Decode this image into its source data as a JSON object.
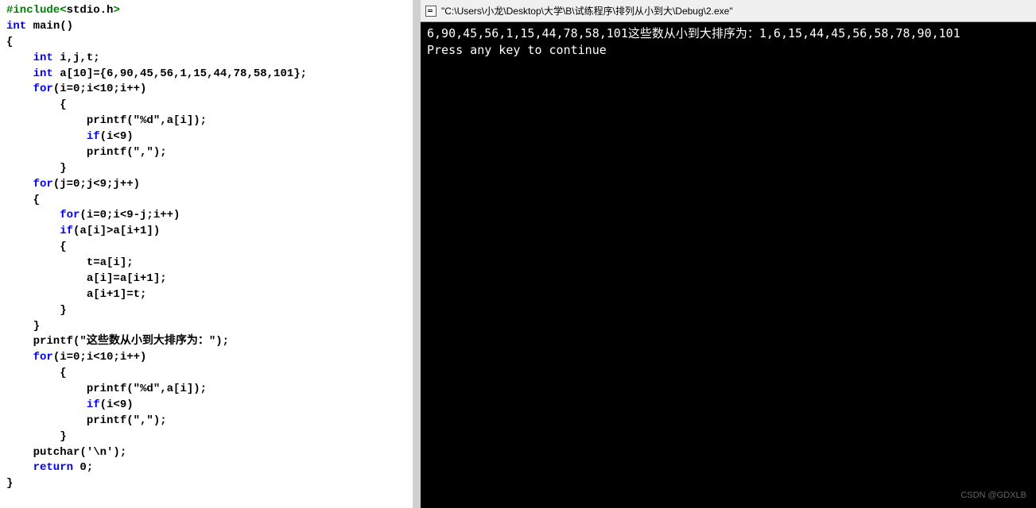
{
  "editor": {
    "line01_p1": "#include<",
    "line01_p2": "stdio.h",
    "line01_p3": ">",
    "line02_p1": "int",
    "line02_p2": " main()",
    "line03": "{",
    "line04_p1": "    int",
    "line04_p2": " i,j,t;",
    "line05_p1": "    int",
    "line05_p2": " a[10]={6,90,45,56,1,15,44,78,58,101};",
    "line06_p1": "    for",
    "line06_p2": "(i=0;i<10;i++)",
    "line07": "        {",
    "line08": "            printf(\"%d\",a[i]);",
    "line09_p1": "            if",
    "line09_p2": "(i<9)",
    "line10": "            printf(\",\");",
    "line11": "        }",
    "line12_p1": "    for",
    "line12_p2": "(j=0;j<9;j++)",
    "line13": "    {",
    "line14_p1": "        for",
    "line14_p2": "(i=0;i<9-j;i++)",
    "line15_p1": "        if",
    "line15_p2": "(a[i]>a[i+1])",
    "line16": "        {",
    "line17": "            t=a[i];",
    "line18": "            a[i]=a[i+1];",
    "line19": "            a[i+1]=t;",
    "line20": "        }",
    "line21": "    }",
    "line22": "    printf(\"这些数从小到大排序为：\");",
    "line23_p1": "    for",
    "line23_p2": "(i=0;i<10;i++)",
    "line24": "        {",
    "line25": "            printf(\"%d\",a[i]);",
    "line26_p1": "            if",
    "line26_p2": "(i<9)",
    "line27": "            printf(\",\");",
    "line28": "        }",
    "line29": "    putchar('\\n');",
    "line30_p1": "    return",
    "line30_p2": " 0;",
    "line31": "}"
  },
  "console": {
    "title": "\"C:\\Users\\小龙\\Desktop\\大学\\B\\试练程序\\排列从小到大\\Debug\\2.exe\"",
    "output_line1": "6,90,45,56,1,15,44,78,58,101这些数从小到大排序为：1,6,15,44,45,56,58,78,90,101",
    "output_line2": "Press any key to continue"
  },
  "watermark": "CSDN @GDXLB"
}
